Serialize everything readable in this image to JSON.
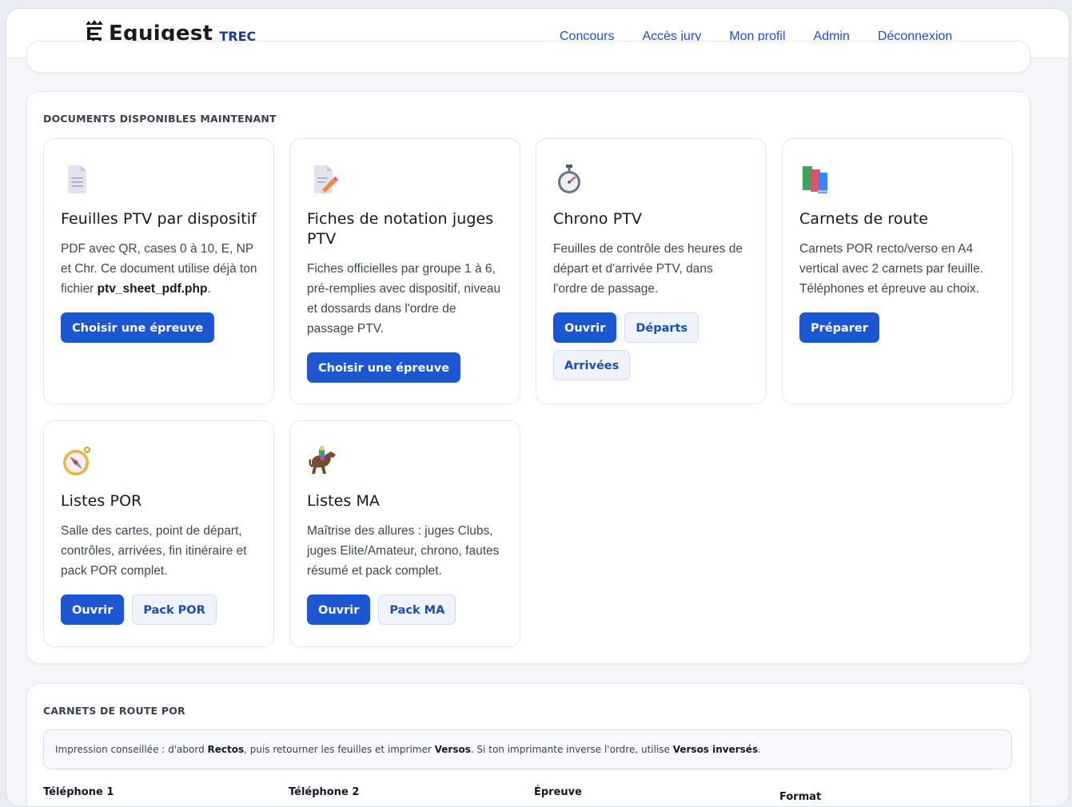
{
  "brand": {
    "name": "Equigest",
    "sub": "TREC"
  },
  "nav": [
    {
      "label": "Concours"
    },
    {
      "label": "Accès jury"
    },
    {
      "label": "Mon profil"
    },
    {
      "label": "Admin"
    },
    {
      "label": "Déconnexion"
    }
  ],
  "documents": {
    "title": "DOCUMENTS DISPONIBLES MAINTENANT",
    "cards": [
      {
        "icon": "document-icon",
        "title": "Feuilles PTV par dispositif",
        "desc_before": "PDF avec QR, cases 0 à 10, E, NP et Chr. Ce document utilise déjà ton fichier ",
        "desc_bold": "ptv_sheet_pdf.php",
        "desc_after": ".",
        "buttons": [
          {
            "label": "Choisir une épreuve",
            "style": "primary"
          }
        ]
      },
      {
        "icon": "memo-pencil-icon",
        "title": "Fiches de notation juges PTV",
        "desc": "Fiches officielles par groupe 1 à 6, pré-remplies avec dispositif, niveau et dossards dans l'ordre de passage PTV.",
        "buttons": [
          {
            "label": "Choisir une épreuve",
            "style": "primary"
          }
        ]
      },
      {
        "icon": "stopwatch-icon",
        "title": "Chrono PTV",
        "desc": "Feuilles de contrôle des heures de départ et d'arrivée PTV, dans l'ordre de passage.",
        "buttons": [
          {
            "label": "Ouvrir",
            "style": "primary"
          },
          {
            "label": "Départs",
            "style": "light"
          },
          {
            "label": "Arrivées",
            "style": "light"
          }
        ]
      },
      {
        "icon": "books-icon",
        "title": "Carnets de route",
        "desc": "Carnets POR recto/verso en A4 vertical avec 2 carnets par feuille. Téléphones et épreuve au choix.",
        "buttons": [
          {
            "label": "Préparer",
            "style": "primary"
          }
        ]
      },
      {
        "icon": "compass-icon",
        "title": "Listes POR",
        "desc": "Salle des cartes, point de départ, contrôles, arrivées, fin itinéraire et pack POR complet.",
        "buttons": [
          {
            "label": "Ouvrir",
            "style": "primary"
          },
          {
            "label": "Pack POR",
            "style": "light"
          }
        ]
      },
      {
        "icon": "horse-racing-icon",
        "title": "Listes MA",
        "desc": "Maîtrise des allures : juges Clubs, juges Elite/Amateur, chrono, fautes résumé et pack complet.",
        "buttons": [
          {
            "label": "Ouvrir",
            "style": "primary"
          },
          {
            "label": "Pack MA",
            "style": "light"
          }
        ]
      }
    ]
  },
  "carnets": {
    "title": "CARNETS DE ROUTE POR",
    "info": {
      "t1": "Impression conseillée : d'abord ",
      "b1": "Rectos",
      "t2": ", puis retourner les feuilles et imprimer ",
      "b2": "Versos",
      "t3": ". Si ton imprimante inverse l'ordre, utilise ",
      "b3": "Versos inversés",
      "t4": "."
    },
    "columns": [
      "Téléphone 1",
      "Téléphone 2",
      "Épreuve",
      "Format"
    ]
  }
}
